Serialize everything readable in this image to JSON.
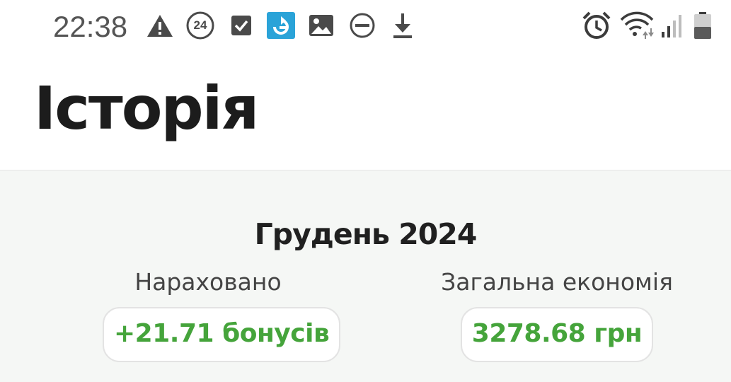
{
  "status_bar": {
    "time": "22:38",
    "badge_24": "24",
    "icons": [
      "warning-icon",
      "badge-24-icon",
      "checkbox-icon",
      "app-refresh-icon",
      "image-icon",
      "do-not-disturb-icon",
      "download-icon",
      "alarm-icon",
      "wifi-icon",
      "signal-icon",
      "battery-icon"
    ]
  },
  "header": {
    "title": "Історія"
  },
  "summary": {
    "month": "Грудень 2024",
    "accrued_label": "Нараховано",
    "accrued_value": "+21.71 бонусів",
    "savings_label": "Загальна економія",
    "savings_value": "3278.68 грн"
  },
  "colors": {
    "accent_green": "#45a43b",
    "summary_bg": "#f5f7f5"
  }
}
